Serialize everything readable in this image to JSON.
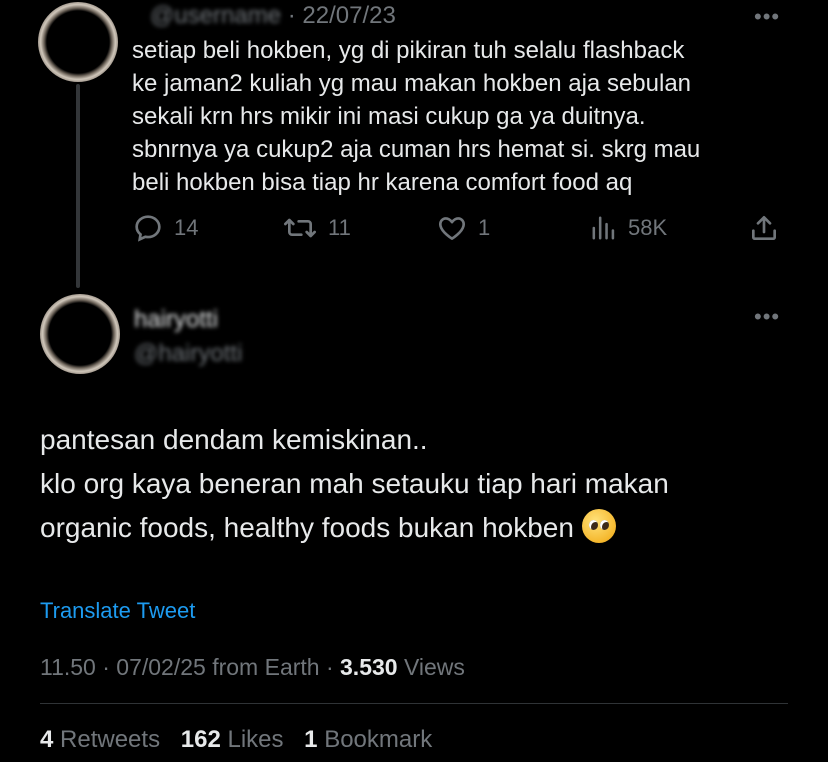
{
  "tweet1": {
    "handle_blurred": "@username",
    "date": "· 22/07/23",
    "text": "setiap beli hokben, yg di pikiran tuh selalu flashback\nke jaman2 kuliah yg mau makan hokben aja sebulan\nsekali krn hrs mikir ini masi cukup ga ya duitnya.\nsbnrnya ya cukup2 aja cuman hrs hemat si. skrg mau\nbeli hokben bisa tiap hr karena comfort food aq",
    "replies": "14",
    "retweets": "11",
    "likes": "1",
    "views": "58K",
    "more": "•••"
  },
  "tweet2": {
    "name_blurred": "hairyotti",
    "handle_blurred": "@hairyotti",
    "more": "•••",
    "text": "pantesan dendam kemiskinan..\nklo org kaya beneran mah setauku tiap hari makan\norganic foods, healthy foods bukan hokben",
    "emoji": "pleading-face",
    "translate": "Translate Tweet",
    "time": "11.50 · 07/02/25 from Earth · ",
    "views_count": "3.530",
    "views_label": " Views",
    "retweets_count": "4",
    "retweets_label": " Retweets",
    "likes_count": "162",
    "likes_label": " Likes",
    "bookmarks_count": "1",
    "bookmarks_label": " Bookmark"
  },
  "colors": {
    "background": "#000000",
    "text": "#e7e9ea",
    "secondary": "#71767b",
    "link": "#1d9bf0"
  }
}
